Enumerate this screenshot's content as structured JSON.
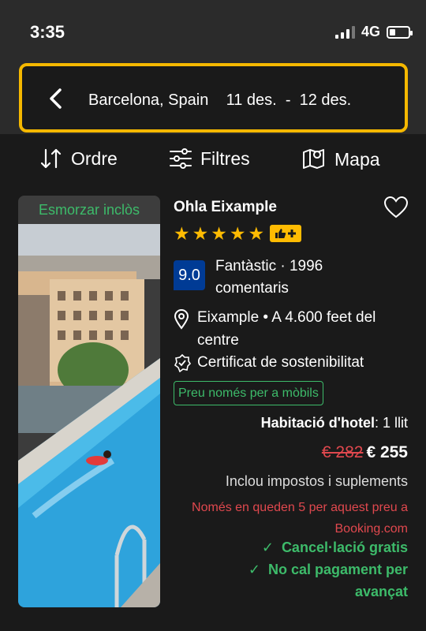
{
  "status": {
    "time": "3:35",
    "network": "4G"
  },
  "search": {
    "destination": "Barcelona, Spain",
    "date_from": "11 des.",
    "date_separator": "-",
    "date_to": "12 des."
  },
  "toolbar": {
    "sort_label": "Ordre",
    "filters_label": "Filtres",
    "map_label": "Mapa"
  },
  "property": {
    "breakfast_label": "Esmorzar inclòs",
    "name": "Ohla Eixample",
    "stars": 5,
    "score": "9.0",
    "score_word": "Fantàstic",
    "reviews": "1996 comentaris",
    "location": "Eixample • A 4.600 feet del centre",
    "sustainability": "Certificat de sostenibilitat",
    "mobile_badge": "Preu només per a mòbils",
    "room_type": "Habitació d'hotel",
    "room_beds": "1 llit",
    "old_price": "€ 282",
    "price": "€ 255",
    "taxes": "Inclou impostos i suplements",
    "scarcity": "Només en queden 5 per aquest preu a Booking.com",
    "free_cancel": "Cancel·lació gratis",
    "no_prepay": "No cal pagament per avançat"
  },
  "colors": {
    "accent_yellow": "#febb02",
    "search_border": "#f5b800",
    "green": "#3dbb6a",
    "red": "#e0484e",
    "score_blue": "#003b95"
  },
  "icons": [
    "chevron-left-icon",
    "sort-icon",
    "sliders-icon",
    "map-icon",
    "heart-icon",
    "location-pin-icon",
    "eco-badge-icon",
    "check-icon"
  ]
}
